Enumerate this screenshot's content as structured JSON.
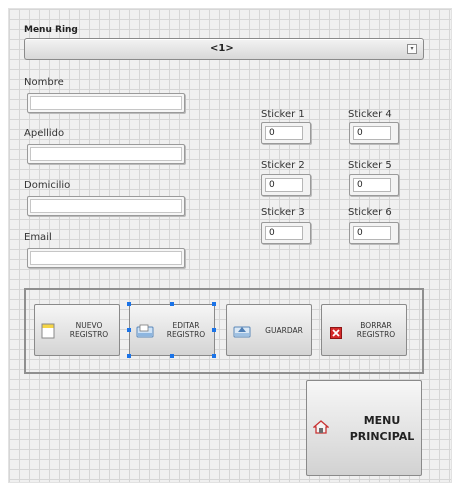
{
  "menu_ring": {
    "label": "Menu Ring",
    "value": "<1>"
  },
  "form": {
    "fields": [
      {
        "label": "Nombre",
        "value": ""
      },
      {
        "label": "Apellido",
        "value": ""
      },
      {
        "label": "Domicilio",
        "value": ""
      },
      {
        "label": "Email",
        "value": ""
      }
    ]
  },
  "stickers": [
    {
      "label": "Sticker 1",
      "value": "0"
    },
    {
      "label": "Sticker 2",
      "value": "0"
    },
    {
      "label": "Sticker 3",
      "value": "0"
    },
    {
      "label": "Sticker 4",
      "value": "0"
    },
    {
      "label": "Sticker 5",
      "value": "0"
    },
    {
      "label": "Sticker 6",
      "value": "0"
    }
  ],
  "buttons": {
    "nuevo": {
      "line1": "NUEVO",
      "line2": "REGISTRO",
      "icon": "new-document-icon"
    },
    "editar": {
      "line1": "EDITAR",
      "line2": "REGISTRO",
      "icon": "edit-document-icon"
    },
    "guardar": {
      "line1": "GUARDAR",
      "icon": "save-tray-icon"
    },
    "borrar": {
      "line1": "BORRAR",
      "line2": "REGISTRO",
      "icon": "delete-x-icon"
    }
  },
  "menu_principal": {
    "line1": "MENU",
    "line2": "PRINCIPAL",
    "icon": "home-icon"
  },
  "colors": {
    "panel_bg": "#f0f0f0",
    "grid": "#d6d6d6",
    "selection": "#1a73e8",
    "delete_red": "#d42a2a"
  }
}
